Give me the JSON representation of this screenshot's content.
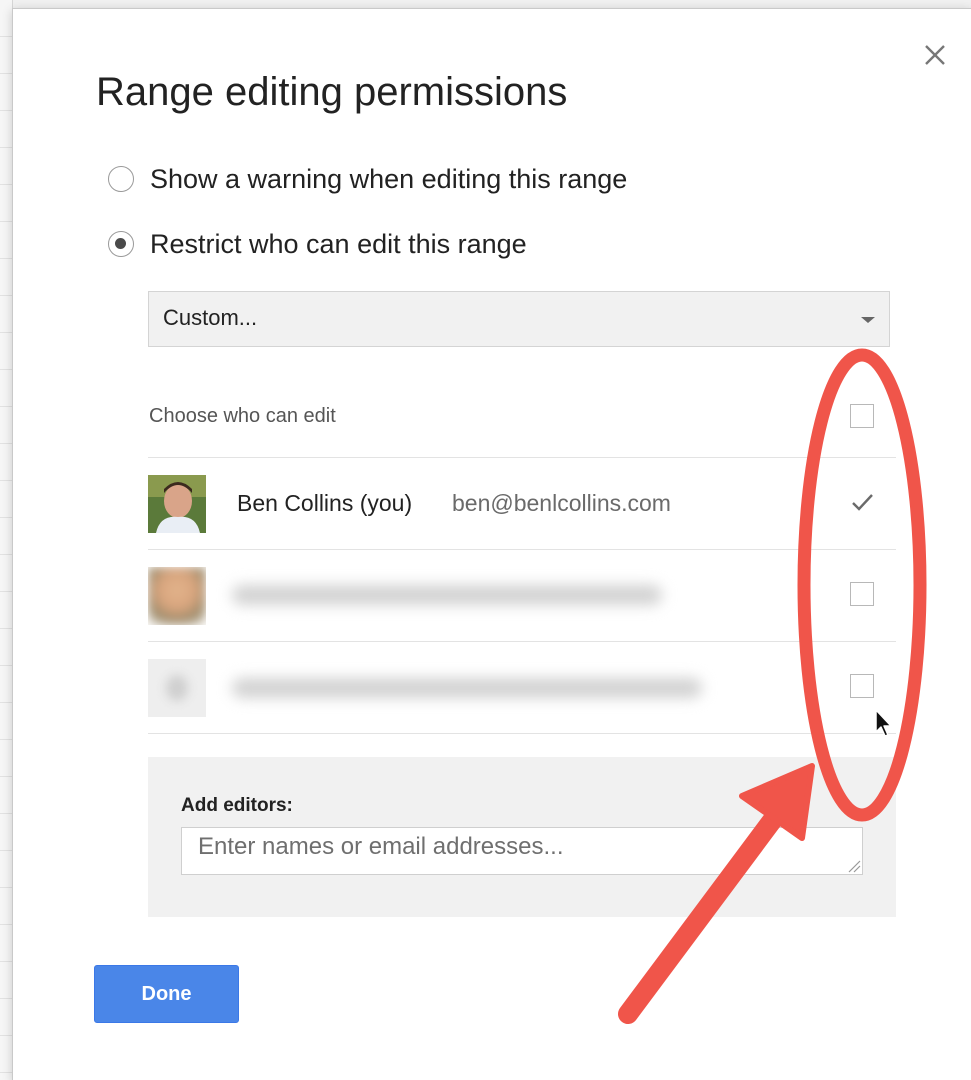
{
  "dialog": {
    "title": "Range editing permissions",
    "close_icon": "close-icon"
  },
  "options": {
    "warning_label": "Show a warning when editing this range",
    "warning_selected": false,
    "restrict_label": "Restrict who can edit this range",
    "restrict_selected": true
  },
  "restrict_select": {
    "value": "Custom..."
  },
  "editors": {
    "choose_label": "Choose who can edit",
    "select_all_checked": false,
    "users": [
      {
        "name": "Ben Collins (you)",
        "email": "ben@benlcollins.com",
        "checked": true
      },
      {
        "name": "",
        "email": "",
        "checked": false,
        "blurred": true
      },
      {
        "name": "",
        "email": "",
        "checked": false,
        "blurred": true
      }
    ]
  },
  "add_editors": {
    "label": "Add editors:",
    "placeholder": "Enter names or email addresses..."
  },
  "footer": {
    "done_label": "Done"
  },
  "annotation": {
    "color": "#f0554a"
  },
  "colors": {
    "primary_button": "#4a86e8",
    "annotation": "#f0554a"
  }
}
